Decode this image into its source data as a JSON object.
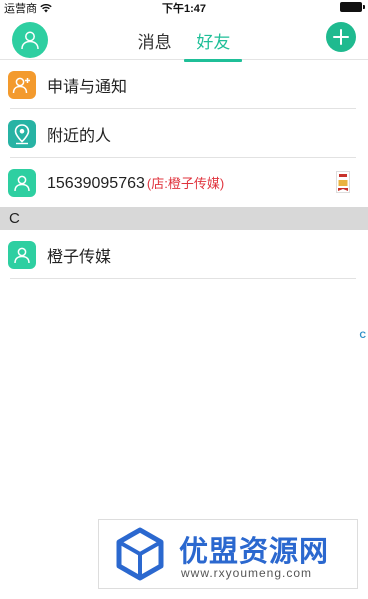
{
  "status_bar": {
    "carrier": "运营商",
    "time": "下午1:47"
  },
  "nav": {
    "tabs": [
      {
        "label": "消息",
        "active": false
      },
      {
        "label": "好友",
        "active": true
      }
    ],
    "accent_color": "#1fbf98"
  },
  "list": {
    "items": [
      {
        "label": "申请与通知",
        "icon": "add-user-icon",
        "color": "#f39a2d"
      },
      {
        "label": "附近的人",
        "icon": "location-pin-icon",
        "color": "#27b3a4"
      },
      {
        "label": "15639095763",
        "sub": "(店:橙子传媒)",
        "icon": "user-icon",
        "color": "#2ecfa1",
        "has_badge": true
      }
    ],
    "sections": [
      {
        "header": "C",
        "items": [
          {
            "label": "橙子传媒",
            "icon": "user-icon",
            "color": "#2ecfa1"
          }
        ]
      }
    ]
  },
  "index_letter": "C",
  "watermark": {
    "title": "优盟资源网",
    "url": "www.rxyoumeng.com"
  }
}
